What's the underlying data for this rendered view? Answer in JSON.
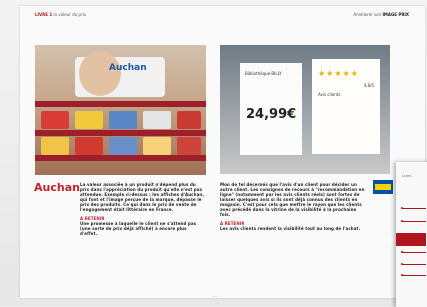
{
  "header": {
    "left_part": "LIVRE 1",
    "left_title": "la valeur du prix",
    "right_prefix": "Améliorer son",
    "right_brand": "IMAGE PRIX"
  },
  "left_photo": {
    "sign_text": "Auchan"
  },
  "right_photo": {
    "card_title": "Bibliothèque BILLY",
    "price": "24,99€",
    "stars": "★★★★★",
    "rating": "4,8/5",
    "review_title": "Avis clients"
  },
  "logos": {
    "left": "Auchan",
    "right": "IKEA"
  },
  "left_text": {
    "paragraph": "La valeur associée à un produit n'dépend plus du prix dans l'appréciation du produit qu'elle n'est pas attendue. Exemple ci-dessus : les affiches d'Auchan, qui font et l'image perçue de la marque, dépasse le prix des produits. Ce qui dans le prix de vente de l'engagement était littéraire en France.",
    "note_label": "A RETENIR",
    "note_text": "Une promesse à laquelle le client ne s'attend pas (une sorte de prix déjà affiché) a encore plus d'effet."
  },
  "right_text": {
    "paragraph": "Mon de tel décernés que l'avis d'un client pour décider un autre client. Les consignes de recours à \"recommandation en ligne\" (notamment par les avis clients réels) sont fortes de laisser quelques avis si ils sont déjà connus des clients en magasin. C'est pour cela que mettre le rayon que les clients avec précédé dans la vitrine de la visibilité à la prochaine fois.",
    "note_label": "A RETENIR",
    "note_text": "Les avis clients rendent la visibilité tout au long de l'achat."
  },
  "pagination": {
    "left": "..."
  },
  "overlap_page": {
    "title": "LIVRE..."
  }
}
